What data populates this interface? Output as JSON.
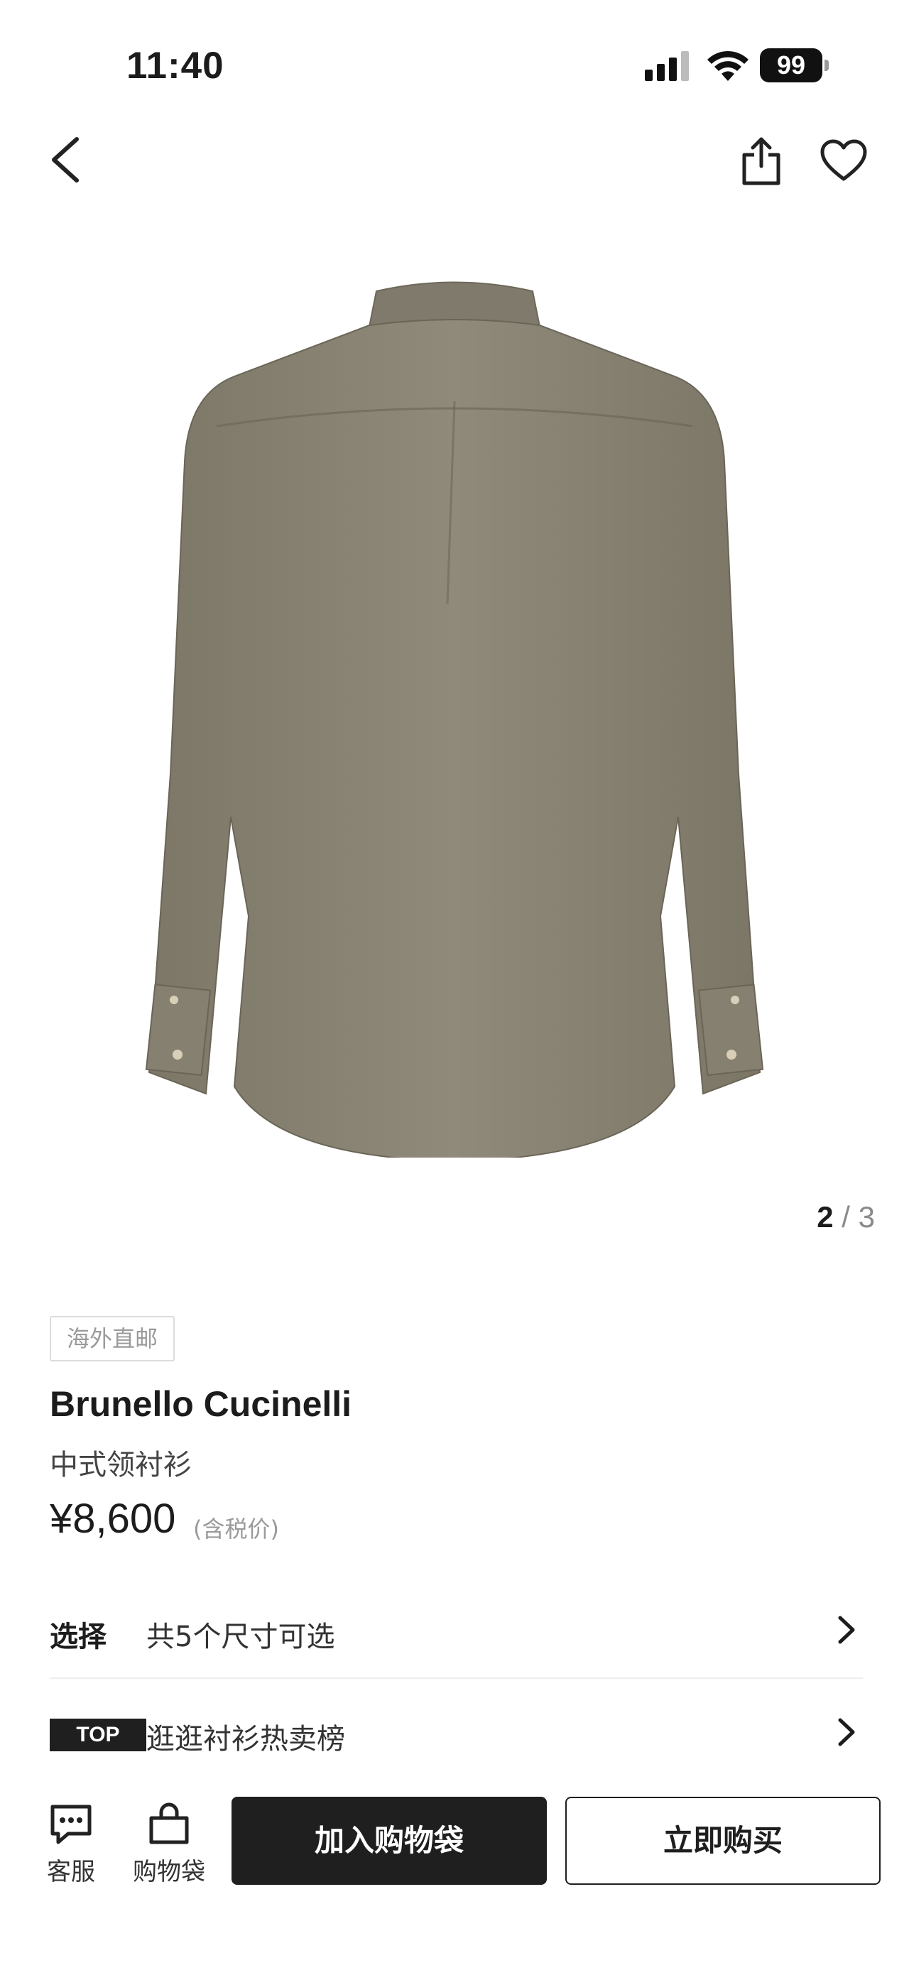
{
  "status_bar": {
    "time": "11:40",
    "battery_level": "99",
    "icons": [
      "signal-icon",
      "wifi-icon",
      "battery-icon"
    ]
  },
  "nav": {
    "icons": [
      "back-arrow-icon",
      "share-icon",
      "heart-icon"
    ]
  },
  "gallery": {
    "current": "2",
    "separator": "/",
    "total": "3"
  },
  "product": {
    "badge": "海外直邮",
    "brand": "Brunello Cucinelli",
    "name": "中式领衬衫",
    "price": "¥8,600",
    "tax_note": "(含税价)",
    "image_color": "#8a8575"
  },
  "select_row": {
    "label": "选择",
    "text": "共5个尺寸可选"
  },
  "top_row": {
    "tag": "TOP",
    "text": "逛逛衬衫热卖榜"
  },
  "bottom_bar": {
    "service_label": "客服",
    "bag_label": "购物袋",
    "add_to_bag": "加入购物袋",
    "buy_now": "立即购买"
  },
  "colors": {
    "primary_dark": "#1f1f1f",
    "muted": "#9a9a9a"
  }
}
